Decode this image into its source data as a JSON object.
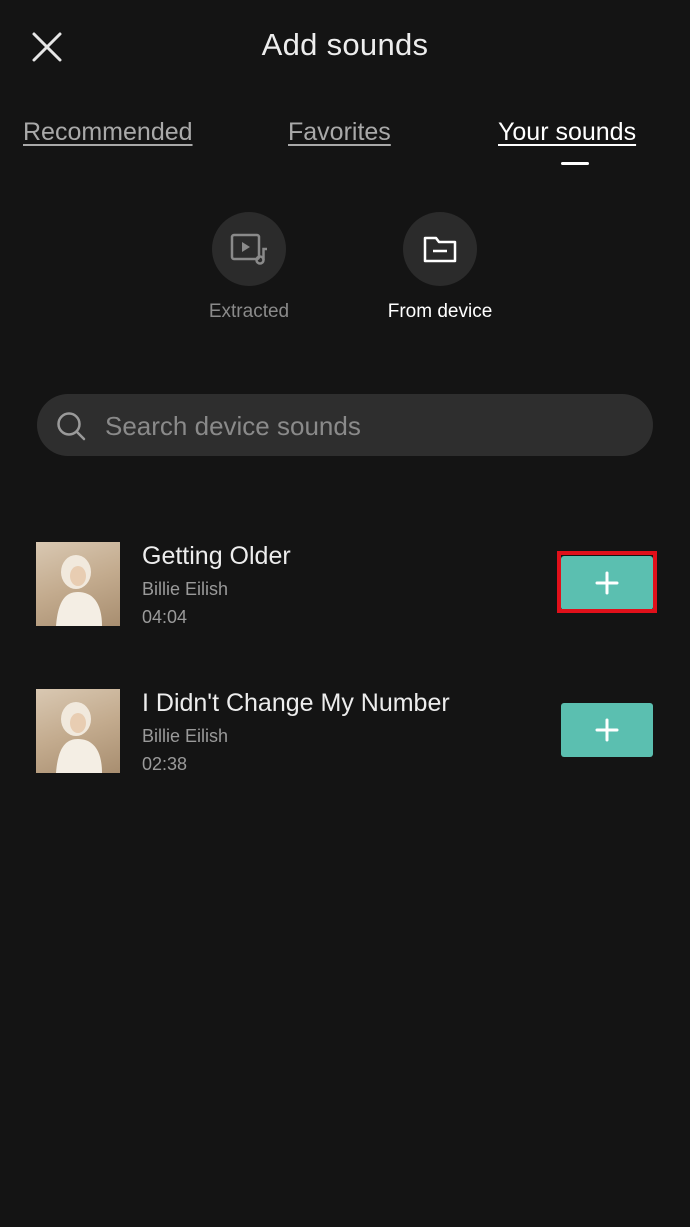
{
  "header": {
    "title": "Add sounds",
    "close_icon": "close-icon"
  },
  "tabs": [
    {
      "label": "Recommended",
      "active": false
    },
    {
      "label": "Favorites",
      "active": false
    },
    {
      "label": "Your sounds",
      "active": true
    }
  ],
  "sources": [
    {
      "label": "Extracted",
      "icon": "video-music-icon",
      "color": "#8a8a8a"
    },
    {
      "label": "From device",
      "icon": "folder-icon",
      "color": "#ffffff"
    }
  ],
  "search": {
    "placeholder": "Search device sounds",
    "value": ""
  },
  "tracks": [
    {
      "title": "Getting Older",
      "artist": "Billie Eilish",
      "duration": "04:04"
    },
    {
      "title": "I Didn't Change My Number",
      "artist": "Billie Eilish",
      "duration": "02:38"
    }
  ],
  "colors": {
    "accent": "#5bbfb0",
    "background": "#141414",
    "highlight": "#e0101a"
  }
}
